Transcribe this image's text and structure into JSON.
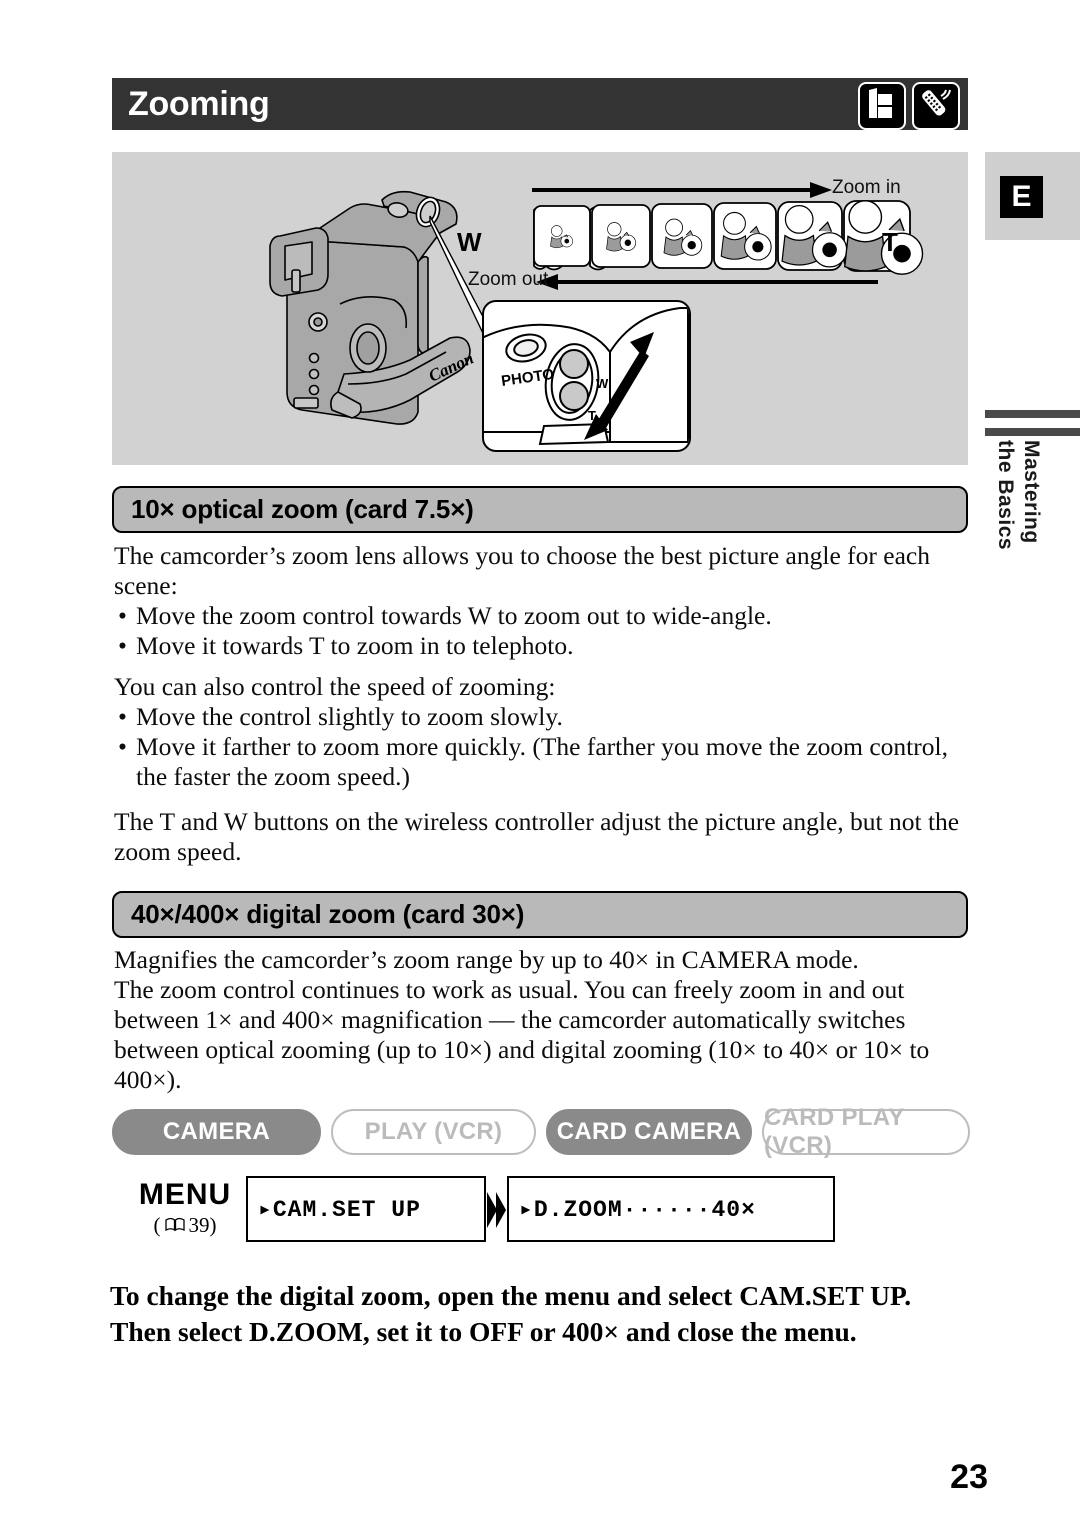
{
  "header": {
    "title": "Zooming",
    "icons": [
      "cassette-icon",
      "wireless-controller-icon"
    ]
  },
  "side_tab": {
    "lang_badge": "E",
    "label_line1": "Mastering",
    "label_line2": "the Basics"
  },
  "illustration": {
    "brand": "Canon",
    "zoom_in_label": "Zoom in",
    "zoom_out_label": "Zoom out",
    "wide_label": "W",
    "tele_label": "T",
    "callout": {
      "photo_button": "PHOTO",
      "wide_mark": "W",
      "tele_mark": "T"
    },
    "frame_count": 6
  },
  "sections": [
    {
      "heading": "10× optical zoom (card 7.5×)",
      "paragraphs": [
        "The camcorder’s zoom lens allows you to choose the best picture angle for each scene:"
      ],
      "bullets": [
        "Move the zoom control towards W to zoom out to wide-angle.",
        "Move it towards T to zoom in to telephoto."
      ],
      "paragraphs2": [
        "You can also control the speed of zooming:"
      ],
      "bullets2": [
        "Move the control slightly to zoom slowly.",
        "Move it farther to zoom more quickly. (The farther you move the zoom control, the faster the zoom speed.)"
      ],
      "paragraphs3": [
        "The T and W buttons on the wireless controller adjust the picture angle, but not the zoom speed."
      ]
    },
    {
      "heading": "40×/400× digital zoom (card 30×)",
      "paragraphs": [
        "Magnifies the camcorder’s zoom range by up to 40× in CAMERA mode.",
        "The zoom control continues to work as usual. You can freely zoom in and out between 1× and 400× magnification — the camcorder automatically switches between optical zooming (up to 10×) and digital zooming (10× to 40× or 10× to 400×)."
      ]
    }
  ],
  "modes": [
    {
      "label": "CAMERA",
      "active": true
    },
    {
      "label": "PLAY (VCR)",
      "active": false
    },
    {
      "label": "CARD CAMERA",
      "active": true
    },
    {
      "label": "CARD PLAY (VCR)",
      "active": false
    }
  ],
  "menu": {
    "label": "MENU",
    "reference_open": "(",
    "reference_page": "39)",
    "book_icon": "book-icon",
    "step1": "▸CAM.SET UP",
    "step2": "▸D.ZOOM······40×"
  },
  "instruction": {
    "line1": "To change the digital zoom, open the menu and select CAM.SET UP.",
    "line2": "Then select D.ZOOM, set it to OFF or 400× and close the menu."
  },
  "page_number": "23",
  "colors": {
    "header_bar": "#333333",
    "pill_fill": "#b9b9b9",
    "illustration_bg": "#d2d2d2",
    "mode_active": "#8a8a8a",
    "mode_inactive_text": "#bbbbbb",
    "side_rule": "#4a4a4a"
  }
}
